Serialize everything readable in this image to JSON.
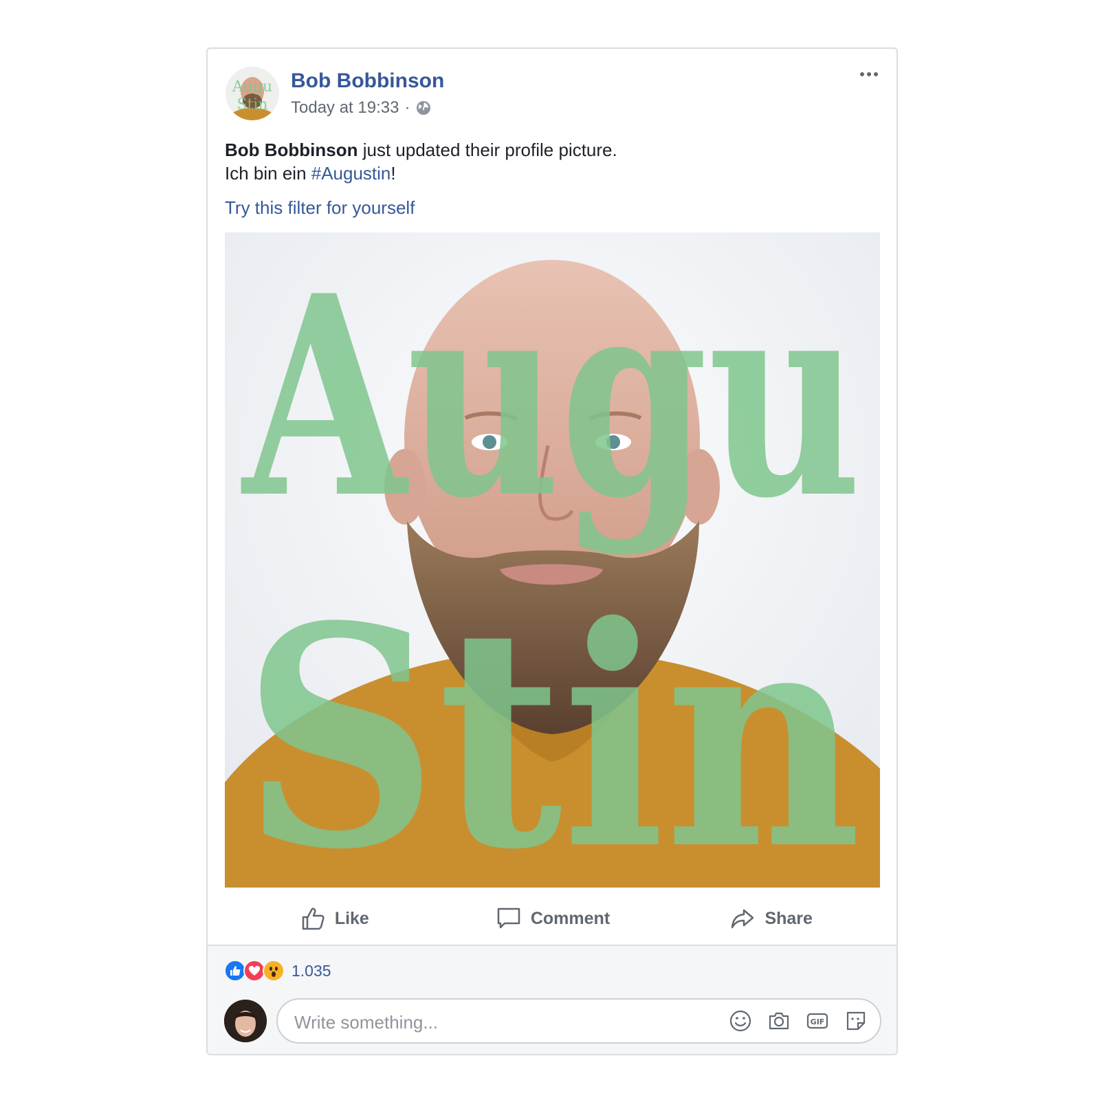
{
  "post": {
    "author": "Bob Bobbinson",
    "timestamp": "Today at 19:33",
    "separator": "·",
    "privacy_icon": "globe-icon",
    "body_author": "Bob Bobbinson",
    "body_action": " just updated their profile picture.",
    "body_line2_prefix": "Ich bin ein ",
    "hashtag": "#Augustin",
    "body_line2_suffix": "!",
    "filter_link": "Try this filter for yourself",
    "photo_overlay_text": [
      "Augu",
      "Stin"
    ],
    "overlay_color": "#7fc68d"
  },
  "actions": {
    "like": "Like",
    "comment": "Comment",
    "share": "Share"
  },
  "reactions": {
    "types": [
      "like",
      "love",
      "wow"
    ],
    "count": "1.035"
  },
  "comment": {
    "placeholder": "Write something...",
    "icons": [
      "emoji-icon",
      "camera-icon",
      "gif-icon",
      "sticker-icon"
    ]
  },
  "colors": {
    "link": "#365899",
    "secondary_text": "#616770",
    "action_text": "#606770",
    "sweater": "#c98f2e"
  }
}
